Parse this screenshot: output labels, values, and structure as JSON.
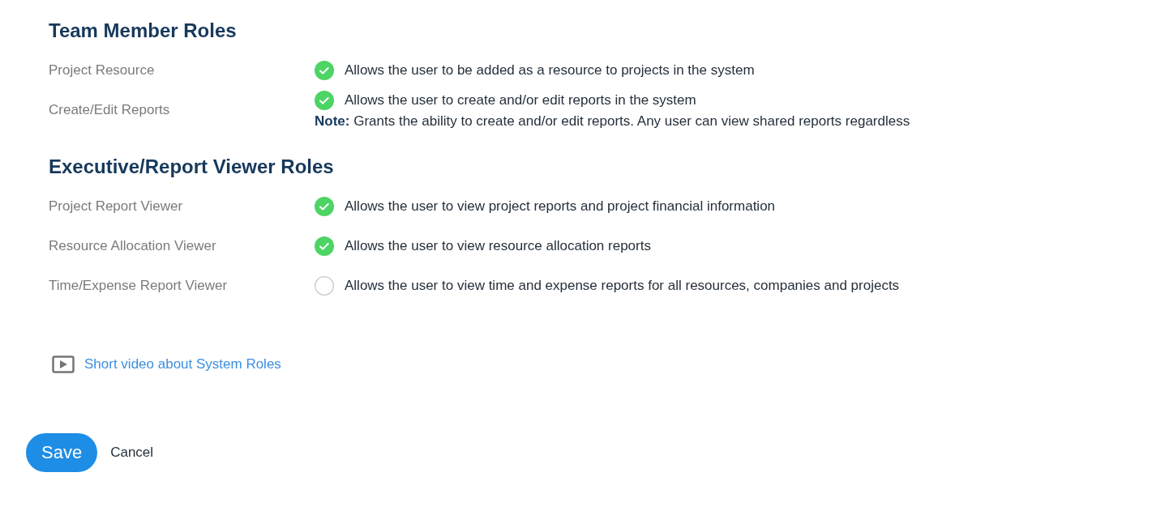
{
  "sections": [
    {
      "title": "Team Member Roles",
      "roles": [
        {
          "label": "Project Resource",
          "checked": true,
          "description": "Allows the user to be added as a resource to projects in the system"
        },
        {
          "label": "Create/Edit Reports",
          "checked": true,
          "description": "Allows the user to create and/or edit reports in the system",
          "note": "**Note:** Grants the ability to create and/or edit reports. Any user can view shared reports regardless"
        }
      ]
    },
    {
      "title": "Executive/Report Viewer Roles",
      "roles": [
        {
          "label": "Project Report Viewer",
          "checked": true,
          "description": "Allows the user to view project reports and project financial information"
        },
        {
          "label": "Resource Allocation Viewer",
          "checked": true,
          "description": "Allows the user to view resource allocation reports"
        },
        {
          "label": "Time/Expense Report Viewer",
          "checked": false,
          "description": "Allows the user to view time and expense reports for all resources, companies and projects"
        }
      ]
    }
  ],
  "video_link": "Short video about System Roles",
  "buttons": {
    "save": "Save",
    "cancel": "Cancel"
  }
}
